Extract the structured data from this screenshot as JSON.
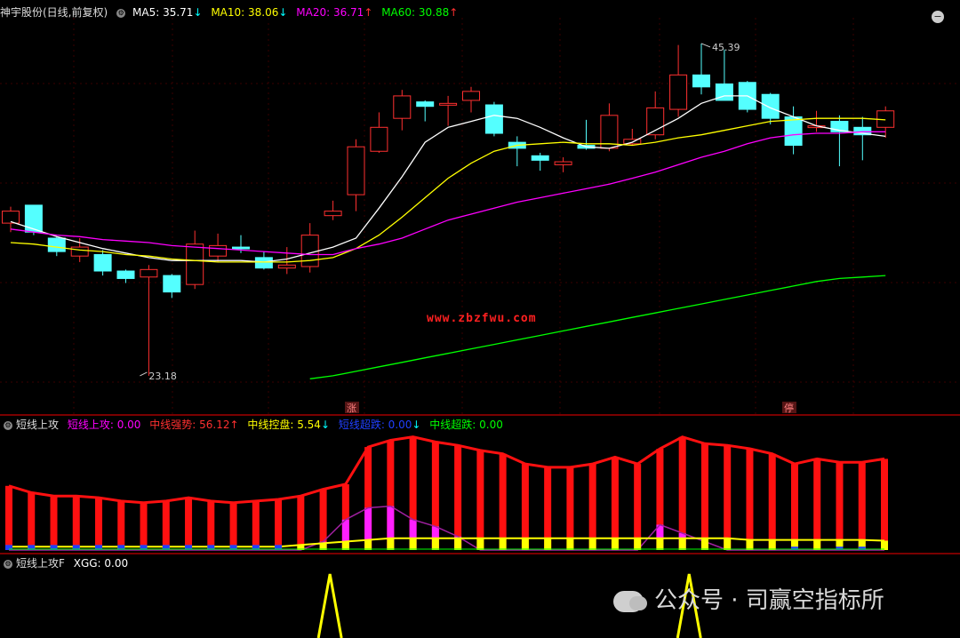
{
  "header": {
    "title": "神宇股份(日线,前复权)",
    "ma_items": [
      {
        "label": "MA5: 35.71",
        "arrow": "↓",
        "color": "#ffffff",
        "arrow_color": "#00ffff"
      },
      {
        "label": "MA10: 38.06",
        "arrow": "↓",
        "color": "#ffff00",
        "arrow_color": "#00ffff"
      },
      {
        "label": "MA20: 36.71",
        "arrow": "↑",
        "color": "#ff00ff",
        "arrow_color": "#ff3030"
      },
      {
        "label": "MA60: 30.88",
        "arrow": "↑",
        "color": "#00ff00",
        "arrow_color": "#ff3030"
      }
    ]
  },
  "panel2_header": {
    "name": "短线上攻",
    "items": [
      {
        "label": "短线上攻: 0.00",
        "color": "#ff00ff"
      },
      {
        "label": "中线强势: 56.12",
        "arrow": "↑",
        "color": "#ff3030"
      },
      {
        "label": "中线控盘: 5.54",
        "arrow": "↓",
        "color": "#ffff00"
      },
      {
        "label": "短线超跌: 0.00",
        "arrow": "↓",
        "color": "#2040ff"
      },
      {
        "label": "中线超跌: 0.00",
        "color": "#00ff00"
      }
    ]
  },
  "panel3_header": {
    "name": "短线上攻F",
    "items": [
      {
        "label": "XGG: 0.00",
        "color": "#ffffff"
      }
    ]
  },
  "url_watermark": "www.zbzfwu.com",
  "watermark": "公众号 · 司赢空指标所",
  "badges": {
    "zhang": "涨",
    "ting": "停"
  },
  "corner_button": "−",
  "colors": {
    "up": "#ff3030",
    "down": "#54ffff",
    "ma5": "#ffffff",
    "ma10": "#ffff00",
    "ma20": "#ff00ff",
    "ma60": "#00ff00"
  },
  "chart_data": [
    {
      "type": "candlestick",
      "title": "神宇股份(日线,前复权)",
      "annotations": [
        {
          "text": "45.39",
          "at_index": 30
        },
        {
          "text": "23.18",
          "at_index": 6
        }
      ],
      "ylim": [
        21,
        47
      ],
      "candles": [
        {
          "o": 33.4,
          "h": 34.5,
          "l": 32.8,
          "c": 34.2
        },
        {
          "o": 34.6,
          "h": 34.6,
          "l": 32.6,
          "c": 32.8
        },
        {
          "o": 32.4,
          "h": 32.5,
          "l": 31.2,
          "c": 31.5
        },
        {
          "o": 31.2,
          "h": 32.4,
          "l": 30.8,
          "c": 31.8
        },
        {
          "o": 31.3,
          "h": 31.6,
          "l": 29.9,
          "c": 30.2
        },
        {
          "o": 30.2,
          "h": 30.3,
          "l": 29.4,
          "c": 29.7
        },
        {
          "o": 29.8,
          "h": 30.6,
          "l": 23.2,
          "c": 30.3
        },
        {
          "o": 29.9,
          "h": 30.0,
          "l": 28.4,
          "c": 28.8
        },
        {
          "o": 29.3,
          "h": 32.9,
          "l": 29.0,
          "c": 32.0
        },
        {
          "o": 31.2,
          "h": 32.7,
          "l": 30.8,
          "c": 31.9
        },
        {
          "o": 31.8,
          "h": 32.6,
          "l": 31.4,
          "c": 31.7
        },
        {
          "o": 31.1,
          "h": 31.5,
          "l": 30.3,
          "c": 30.4
        },
        {
          "o": 30.4,
          "h": 31.8,
          "l": 30.0,
          "c": 30.6
        },
        {
          "o": 30.5,
          "h": 33.4,
          "l": 30.1,
          "c": 32.6
        },
        {
          "o": 33.9,
          "h": 34.9,
          "l": 33.6,
          "c": 34.2
        },
        {
          "o": 35.3,
          "h": 39.0,
          "l": 34.2,
          "c": 38.5
        },
        {
          "o": 38.2,
          "h": 40.8,
          "l": 38.1,
          "c": 39.8
        },
        {
          "o": 40.4,
          "h": 42.3,
          "l": 39.6,
          "c": 41.9
        },
        {
          "o": 41.5,
          "h": 41.6,
          "l": 40.2,
          "c": 41.2
        },
        {
          "o": 41.3,
          "h": 41.9,
          "l": 39.9,
          "c": 41.4
        },
        {
          "o": 41.6,
          "h": 42.5,
          "l": 40.8,
          "c": 42.2
        },
        {
          "o": 41.3,
          "h": 41.5,
          "l": 39.2,
          "c": 39.4
        },
        {
          "o": 38.8,
          "h": 39.2,
          "l": 37.2,
          "c": 38.4
        },
        {
          "o": 37.9,
          "h": 38.1,
          "l": 36.9,
          "c": 37.6
        },
        {
          "o": 37.3,
          "h": 37.8,
          "l": 36.8,
          "c": 37.5
        },
        {
          "o": 38.6,
          "h": 40.3,
          "l": 38.3,
          "c": 38.4
        },
        {
          "o": 38.4,
          "h": 41.4,
          "l": 38.2,
          "c": 40.6
        },
        {
          "o": 38.7,
          "h": 39.7,
          "l": 38.6,
          "c": 39.0
        },
        {
          "o": 39.3,
          "h": 42.2,
          "l": 39.0,
          "c": 41.1
        },
        {
          "o": 41.0,
          "h": 45.3,
          "l": 40.5,
          "c": 43.3
        },
        {
          "o": 43.3,
          "h": 45.4,
          "l": 42.0,
          "c": 42.5
        },
        {
          "o": 42.7,
          "h": 45.0,
          "l": 41.8,
          "c": 41.6
        },
        {
          "o": 42.8,
          "h": 42.9,
          "l": 40.8,
          "c": 41.0
        },
        {
          "o": 42.0,
          "h": 42.1,
          "l": 40.0,
          "c": 40.4
        },
        {
          "o": 40.5,
          "h": 41.2,
          "l": 38.0,
          "c": 38.6
        },
        {
          "o": 39.8,
          "h": 40.9,
          "l": 39.5,
          "c": 39.9
        },
        {
          "o": 40.2,
          "h": 40.6,
          "l": 37.2,
          "c": 39.5
        },
        {
          "o": 39.8,
          "h": 40.5,
          "l": 37.6,
          "c": 39.3
        },
        {
          "o": 39.8,
          "h": 41.2,
          "l": 39.1,
          "c": 40.9
        }
      ],
      "ma_lines": [
        {
          "name": "MA5",
          "values": [
            33.5,
            33.0,
            32.5,
            32.1,
            31.7,
            31.4,
            31.1,
            30.9,
            30.9,
            30.9,
            30.9,
            30.8,
            31.0,
            31.4,
            31.8,
            32.4,
            34.4,
            36.5,
            38.8,
            39.8,
            40.2,
            40.6,
            40.4,
            39.8,
            39.1,
            38.5,
            38.4,
            38.8,
            39.6,
            40.4,
            41.4,
            41.9,
            41.9,
            41.1,
            40.5,
            39.9,
            39.6,
            39.4,
            39.2
          ]
        },
        {
          "name": "MA10",
          "values": [
            32.1,
            32.0,
            31.8,
            31.6,
            31.5,
            31.3,
            31.2,
            31.0,
            30.9,
            30.8,
            30.8,
            30.8,
            30.8,
            30.9,
            31.1,
            31.7,
            32.6,
            33.8,
            35.1,
            36.4,
            37.4,
            38.2,
            38.6,
            38.7,
            38.8,
            38.7,
            38.7,
            38.6,
            38.8,
            39.1,
            39.3,
            39.6,
            39.9,
            40.2,
            40.3,
            40.4,
            40.4,
            40.4,
            40.3
          ]
        },
        {
          "name": "MA20",
          "values": [
            33.0,
            32.8,
            32.6,
            32.5,
            32.3,
            32.2,
            32.1,
            31.9,
            31.8,
            31.7,
            31.6,
            31.5,
            31.4,
            31.3,
            31.3,
            31.7,
            32.0,
            32.4,
            33.0,
            33.6,
            34.0,
            34.4,
            34.8,
            35.1,
            35.4,
            35.7,
            36.0,
            36.4,
            36.8,
            37.3,
            37.8,
            38.2,
            38.7,
            39.1,
            39.3,
            39.4,
            39.4,
            39.5,
            39.5
          ]
        },
        {
          "name": "MA60",
          "values": [
            null,
            null,
            null,
            null,
            null,
            null,
            null,
            null,
            null,
            null,
            null,
            null,
            null,
            23.0,
            23.2,
            23.5,
            23.8,
            24.1,
            24.4,
            24.7,
            25.0,
            25.3,
            25.6,
            25.9,
            26.2,
            26.5,
            26.8,
            27.1,
            27.4,
            27.7,
            28.0,
            28.3,
            28.6,
            28.9,
            29.2,
            29.5,
            29.7,
            29.8,
            29.9
          ]
        }
      ]
    },
    {
      "type": "bar",
      "title": "短线上攻",
      "ylim": [
        0,
        70
      ],
      "series": [
        {
          "name": "中线强势",
          "values": [
            38,
            34,
            32,
            32,
            31,
            29,
            28,
            29,
            31,
            29,
            28,
            29,
            30,
            32,
            36,
            39,
            61,
            65,
            67,
            64,
            62,
            59,
            57,
            51,
            49,
            49,
            51,
            55,
            51,
            60,
            67,
            63,
            62,
            60,
            57,
            51,
            54,
            52,
            52,
            54
          ]
        },
        {
          "name": "短线上攻",
          "values": [
            0,
            0,
            0,
            0,
            0,
            0,
            0,
            0,
            0,
            0,
            0,
            0,
            0,
            0,
            5,
            18,
            25,
            26,
            18,
            14,
            8,
            0,
            0,
            0,
            0,
            0,
            0,
            0,
            0,
            15,
            10,
            5,
            0,
            0,
            0,
            0,
            0,
            0,
            0,
            0
          ]
        },
        {
          "name": "中线控盘",
          "values": [
            2,
            2,
            2,
            2,
            2,
            2,
            2,
            2,
            2,
            2,
            2,
            2,
            2,
            3,
            4,
            5,
            6,
            7,
            7,
            7,
            7,
            7,
            7,
            7,
            7,
            7,
            7,
            7,
            7,
            7,
            7,
            7,
            7,
            6,
            6,
            6,
            6,
            6,
            6,
            5.54
          ]
        },
        {
          "name": "短线超跌",
          "values": [
            3,
            3,
            3,
            3,
            3,
            3,
            3,
            3,
            3,
            3,
            3,
            3,
            3,
            0,
            0,
            0,
            0,
            0,
            0,
            0,
            0,
            0,
            0,
            0,
            0,
            0,
            0,
            0,
            0,
            0,
            0,
            0,
            0,
            0,
            0,
            2,
            0,
            2,
            2,
            0
          ]
        }
      ]
    },
    {
      "type": "line",
      "title": "短线上攻F",
      "series": [
        {
          "name": "XGG",
          "spikes_at": [
            14.3,
            30.3
          ]
        }
      ]
    }
  ]
}
